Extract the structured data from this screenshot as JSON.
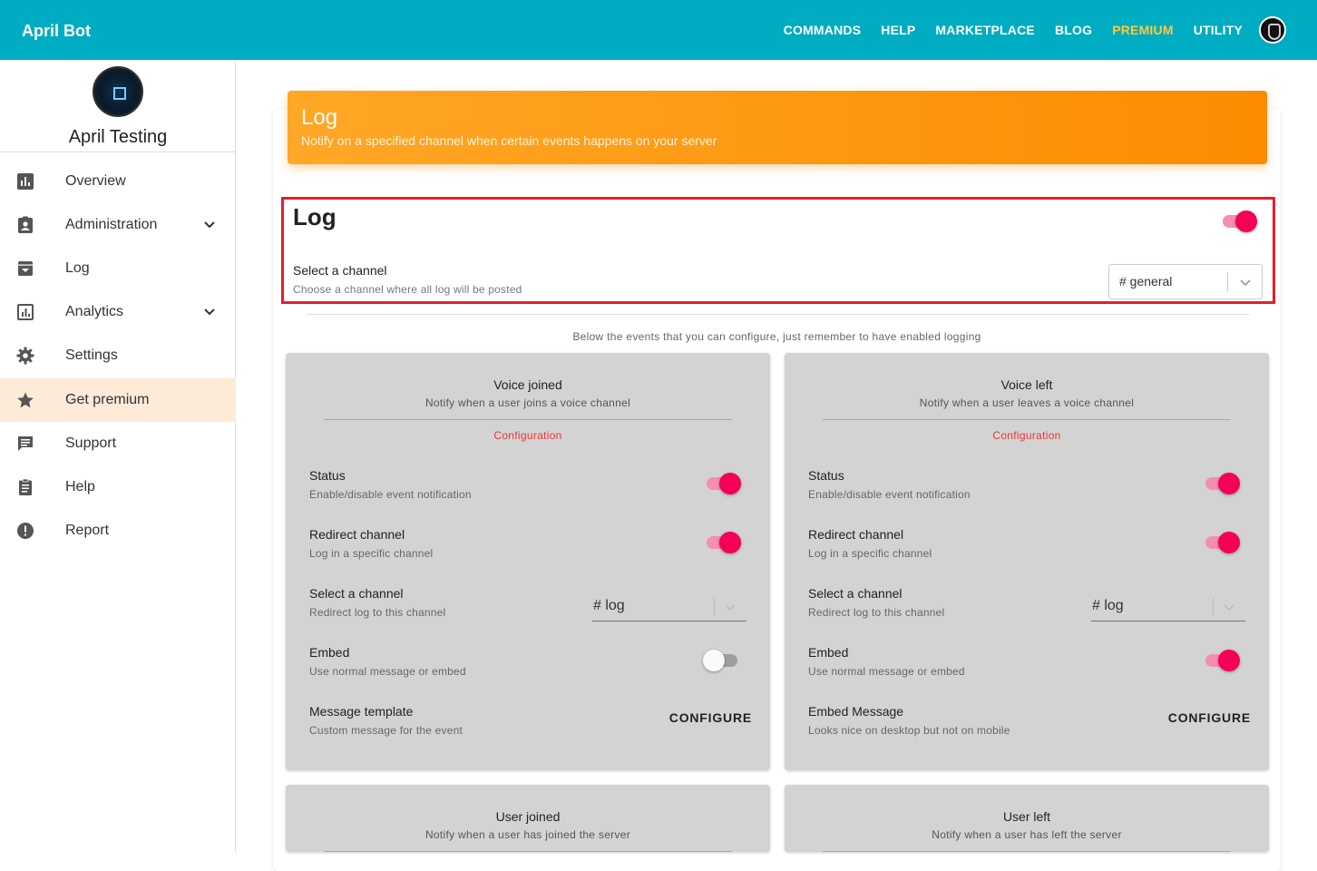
{
  "topbar": {
    "brand": "April Bot",
    "nav": [
      {
        "label": "COMMANDS",
        "highlight": false
      },
      {
        "label": "HELP",
        "highlight": false
      },
      {
        "label": "MARKETPLACE",
        "highlight": false
      },
      {
        "label": "BLOG",
        "highlight": false
      },
      {
        "label": "PREMIUM",
        "highlight": true
      },
      {
        "label": "UTILITY",
        "highlight": false
      }
    ]
  },
  "sidebar": {
    "server_name": "April Testing",
    "items": [
      {
        "label": "Overview",
        "icon": "bar-chart-icon",
        "expandable": false,
        "active": false
      },
      {
        "label": "Administration",
        "icon": "badge-icon",
        "expandable": true,
        "active": false
      },
      {
        "label": "Log",
        "icon": "archive-icon",
        "expandable": false,
        "active": false
      },
      {
        "label": "Analytics",
        "icon": "analytics-icon",
        "expandable": true,
        "active": false
      },
      {
        "label": "Settings",
        "icon": "gear-icon",
        "expandable": false,
        "active": false
      },
      {
        "label": "Get premium",
        "icon": "star-icon",
        "expandable": false,
        "active": true
      },
      {
        "label": "Support",
        "icon": "chat-icon",
        "expandable": false,
        "active": false
      },
      {
        "label": "Help",
        "icon": "clipboard-icon",
        "expandable": false,
        "active": false
      },
      {
        "label": "Report",
        "icon": "alert-icon",
        "expandable": false,
        "active": false
      }
    ]
  },
  "header": {
    "title": "Log",
    "subtitle": "Notify on a specified channel when certain events happens on your server"
  },
  "log": {
    "title": "Log",
    "enabled": true,
    "select_title": "Select a channel",
    "select_sub": "Choose a channel where all log will be posted",
    "channel": "# general"
  },
  "events_note": "Below the events that you can configure, just remember to have enabled logging",
  "events": [
    {
      "title": "Voice joined",
      "subtitle": "Notify when a user joins a voice channel",
      "config_label": "Configuration",
      "rows": {
        "status": {
          "title": "Status",
          "sub": "Enable/disable event notification",
          "on": true
        },
        "redirect": {
          "title": "Redirect channel",
          "sub": "Log in a specific channel",
          "on": true
        },
        "select": {
          "title": "Select a channel",
          "sub": "Redirect log to this channel",
          "value": "# log"
        },
        "embed": {
          "title": "Embed",
          "sub": "Use normal message or embed",
          "on": false
        },
        "template": {
          "title": "Message template",
          "sub": "Custom message for the event",
          "button": "CONFIGURE"
        }
      }
    },
    {
      "title": "Voice left",
      "subtitle": "Notify when a user leaves a voice channel",
      "config_label": "Configuration",
      "rows": {
        "status": {
          "title": "Status",
          "sub": "Enable/disable event notification",
          "on": true
        },
        "redirect": {
          "title": "Redirect channel",
          "sub": "Log in a specific channel",
          "on": true
        },
        "select": {
          "title": "Select a channel",
          "sub": "Redirect log to this channel",
          "value": "# log"
        },
        "embed": {
          "title": "Embed",
          "sub": "Use normal message or embed",
          "on": true
        },
        "template": {
          "title": "Embed Message",
          "sub": "Looks nice on desktop but not on mobile",
          "button": "CONFIGURE"
        }
      }
    },
    {
      "title": "User joined",
      "subtitle": "Notify when a user has joined the server"
    },
    {
      "title": "User left",
      "subtitle": "Notify when a user has left the server"
    }
  ],
  "colors": {
    "topbar": "#00acc1",
    "premium": "#ffc940",
    "header_gradient_start": "#ffa726",
    "header_gradient_end": "#fb8c00",
    "toggle_on": "#f50057",
    "highlight_box": "#e0202a",
    "active_sidebar": "#fdebd7"
  }
}
